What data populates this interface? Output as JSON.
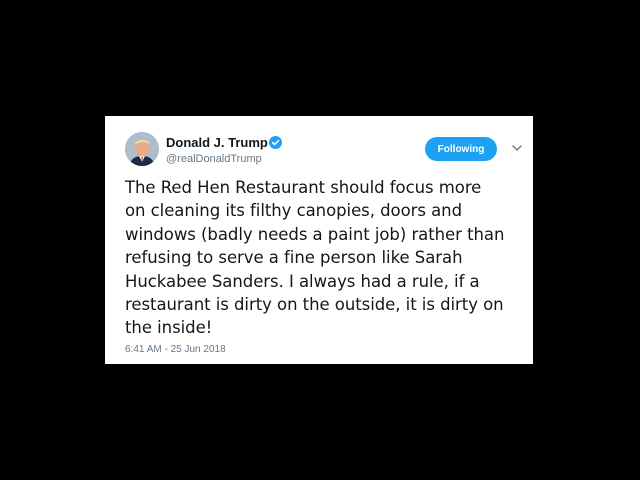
{
  "tweet": {
    "author": {
      "display_name": "Donald J. Trump",
      "handle": "@realDonaldTrump",
      "verified": true,
      "avatar_icon": "profile-photo-icon"
    },
    "follow_button_label": "Following",
    "menu_icon": "chevron-down-icon",
    "text": "The Red Hen Restaurant should focus more\non cleaning its filthy canopies, doors and\nwindows (badly needs a paint job) rather than\nrefusing to serve a fine person like Sarah\nHuckabee Sanders. I always had a rule, if a\nrestaurant is dirty on the outside, it is dirty on\nthe inside!",
    "timestamp": "6:41 AM - 25 Jun 2018"
  },
  "colors": {
    "background": "#000000",
    "card": "#ffffff",
    "accent": "#1da1f2",
    "secondary_text": "#657786",
    "primary_text": "#14171a"
  }
}
